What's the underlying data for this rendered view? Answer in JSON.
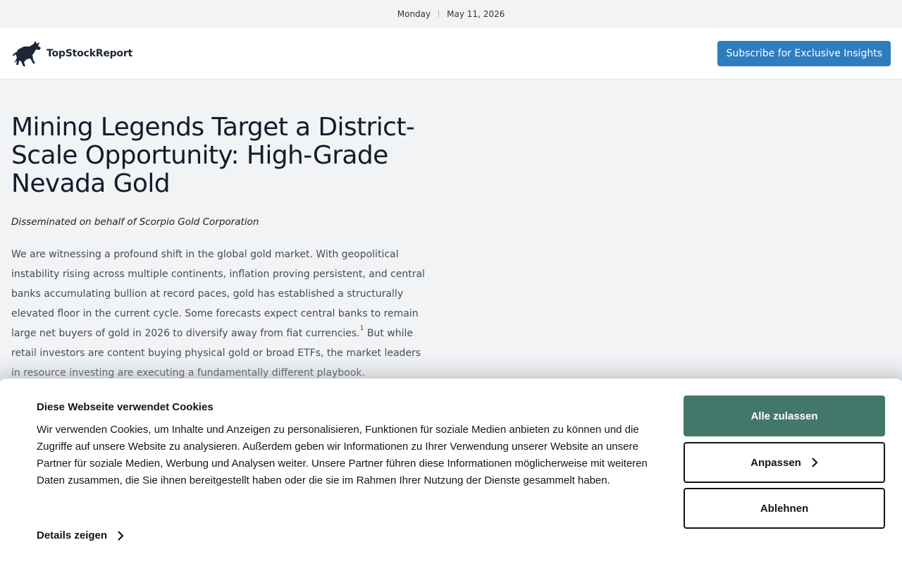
{
  "datebar": {
    "day": "Monday",
    "date": "May 11, 2026"
  },
  "header": {
    "logo_text": "TopStockReport",
    "subscribe_label": "Subscribe for Exclusive Insights",
    "accent_color": "#2f7cbf"
  },
  "article": {
    "title": "Mining Legends Target a District-Scale Opportunity: High-Grade Nevada Gold",
    "byline": "Disseminated on behalf of Scorpio Gold Corporation",
    "paragraph_before_ref": "We are witnessing a profound shift in the global gold market. With geopolitical instability rising across multiple continents, inflation proving persistent, and central banks accumulating bullion at record paces, gold has established a structurally elevated floor in the current cycle. Some forecasts expect central banks to remain large net buyers of gold in 2026 to diversify away from fiat currencies.",
    "footnote_ref": "1",
    "paragraph_after_ref": " But while retail investors are content buying physical gold or broad ETFs, the market leaders in resource investing are executing a fundamentally different playbook."
  },
  "cookie_banner": {
    "title": "Diese Webseite verwendet Cookies",
    "text": "Wir verwenden Cookies, um Inhalte und Anzeigen zu personalisieren, Funktionen für soziale Medien anbieten zu können und die Zugriffe auf unsere Website zu analysieren. Außerdem geben wir Informationen zu Ihrer Verwendung unserer Website an unsere Partner für soziale Medien, Werbung und Analysen weiter. Unsere Partner führen diese Informationen möglicherweise mit weiteren Daten zusammen, die Sie ihnen bereitgestellt haben oder die sie im Rahmen Ihrer Nutzung der Dienste gesammelt haben.",
    "details_label": "Details zeigen",
    "allow_all_label": "Alle zulassen",
    "customize_label": "Anpassen",
    "reject_label": "Ablehnen",
    "primary_color": "#43776a"
  }
}
